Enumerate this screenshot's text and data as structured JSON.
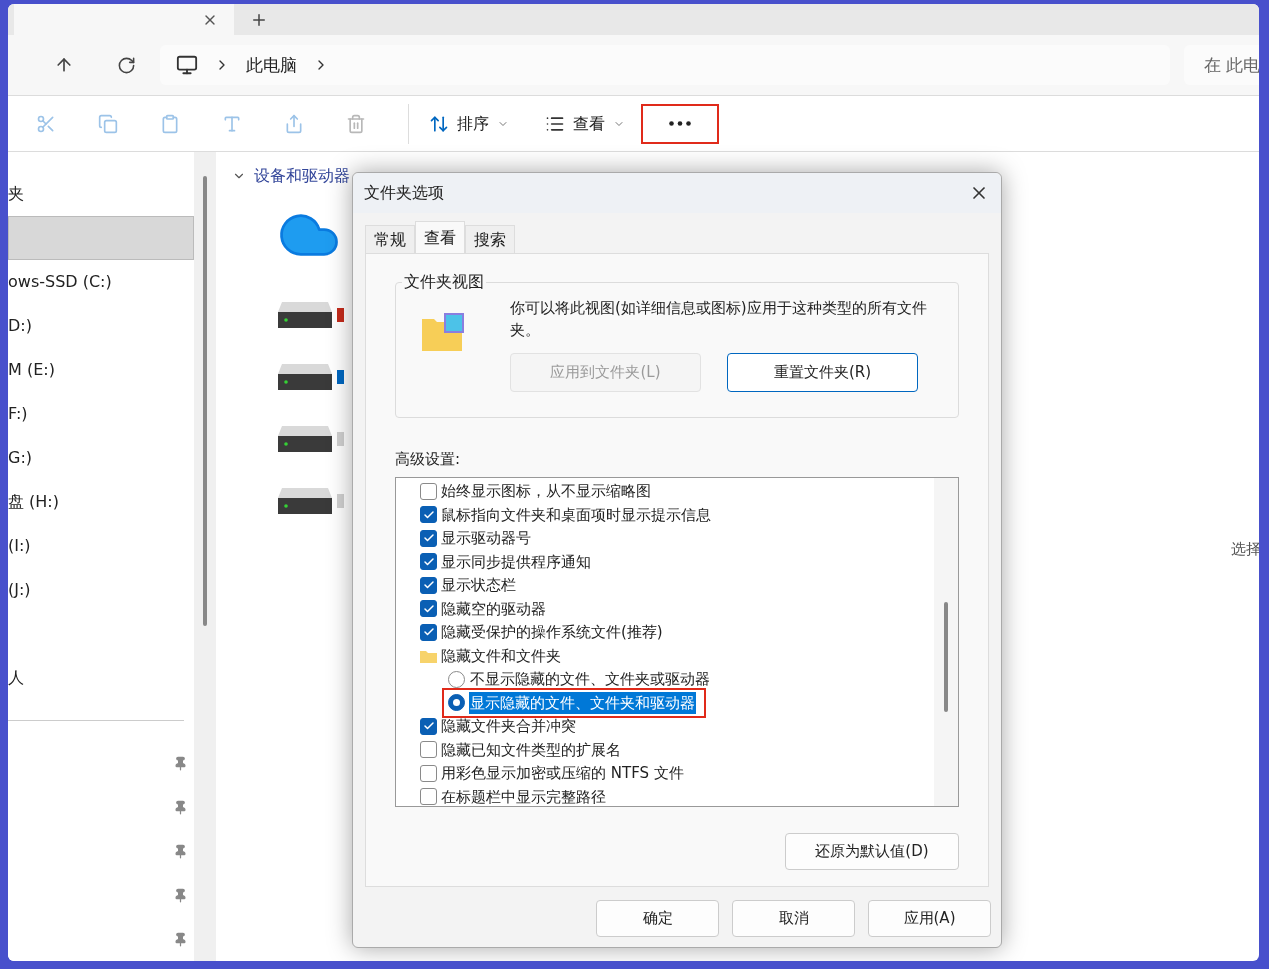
{
  "address": {
    "crumbs": [
      "此电脑"
    ]
  },
  "search": {
    "placeholder": "在 此电"
  },
  "toolbar": {
    "sort": "排序",
    "view": "查看",
    "more_highlighted": true
  },
  "sidebar": {
    "items": [
      {
        "kind": "item",
        "label": "夹",
        "selected": false
      },
      {
        "kind": "item",
        "selected": true
      },
      {
        "kind": "item",
        "label": "ows-SSD (C:)",
        "selected": false
      },
      {
        "kind": "item",
        "label": "D:)",
        "selected": false
      },
      {
        "kind": "item",
        "label": "M (E:)",
        "selected": false
      },
      {
        "kind": "item",
        "label": "F:)",
        "selected": false
      },
      {
        "kind": "item",
        "label": "G:)",
        "selected": false
      },
      {
        "kind": "item",
        "label": "盘 (H:)",
        "selected": false
      },
      {
        "kind": "item",
        "label": "(I:)",
        "selected": false
      },
      {
        "kind": "item",
        "label": "(J:)",
        "selected": false
      },
      {
        "kind": "gap"
      },
      {
        "kind": "item",
        "label": "人",
        "selected": false
      },
      {
        "kind": "divider"
      },
      {
        "kind": "pin"
      },
      {
        "kind": "pin"
      },
      {
        "kind": "pin"
      },
      {
        "kind": "pin"
      },
      {
        "kind": "pin"
      }
    ]
  },
  "content": {
    "group": "设备和驱动器",
    "expanded": true,
    "items": [
      {
        "kind": "cloud"
      },
      {
        "kind": "drive",
        "color": "#c42b1c"
      },
      {
        "kind": "drive",
        "color": "#0067c0"
      },
      {
        "kind": "drive",
        "color": "#d0d0d0"
      },
      {
        "kind": "drive",
        "color": "#d0d0d0"
      }
    ]
  },
  "status_text": "选择",
  "dialog": {
    "title": "文件夹选项",
    "tabs": [
      {
        "label": "常规",
        "selected": false
      },
      {
        "label": "查看",
        "selected": true
      },
      {
        "label": "搜索",
        "selected": false
      }
    ],
    "folder_view": {
      "legend": "文件夹视图",
      "description": "你可以将此视图(如详细信息或图标)应用于这种类型的所有文件夹。",
      "buttons": [
        {
          "label": "应用到文件夹(L)",
          "disabled": true
        },
        {
          "label": "重置文件夹(R)",
          "disabled": false
        }
      ]
    },
    "advanced_label": "高级设置:",
    "options": [
      {
        "kind": "checkbox",
        "label": "始终显示图标，从不显示缩略图",
        "checked": false
      },
      {
        "kind": "checkbox",
        "label": "鼠标指向文件夹和桌面项时显示提示信息",
        "checked": true
      },
      {
        "kind": "checkbox",
        "label": "显示驱动器号",
        "checked": true
      },
      {
        "kind": "checkbox",
        "label": "显示同步提供程序通知",
        "checked": true
      },
      {
        "kind": "checkbox",
        "label": "显示状态栏",
        "checked": true
      },
      {
        "kind": "checkbox",
        "label": "隐藏空的驱动器",
        "checked": true
      },
      {
        "kind": "checkbox",
        "label": "隐藏受保护的操作系统文件(推荐)",
        "checked": true
      },
      {
        "kind": "folder",
        "label": "隐藏文件和文件夹",
        "children": [
          {
            "kind": "radio",
            "label": "不显示隐藏的文件、文件夹或驱动器",
            "selected": false,
            "highlighted": false
          },
          {
            "kind": "radio",
            "label": "显示隐藏的文件、文件夹和驱动器",
            "selected": true,
            "highlighted": true
          }
        ]
      },
      {
        "kind": "checkbox",
        "label": "隐藏文件夹合并冲突",
        "checked": true
      },
      {
        "kind": "checkbox",
        "label": "隐藏已知文件类型的扩展名",
        "checked": false
      },
      {
        "kind": "checkbox",
        "label": "用彩色显示加密或压缩的 NTFS 文件",
        "checked": false
      },
      {
        "kind": "checkbox",
        "label": "在标题栏中显示完整路径",
        "checked": false
      }
    ],
    "restore_button": "还原为默认值(D)",
    "footer_buttons": [
      "确定",
      "取消",
      "应用(A)"
    ]
  }
}
